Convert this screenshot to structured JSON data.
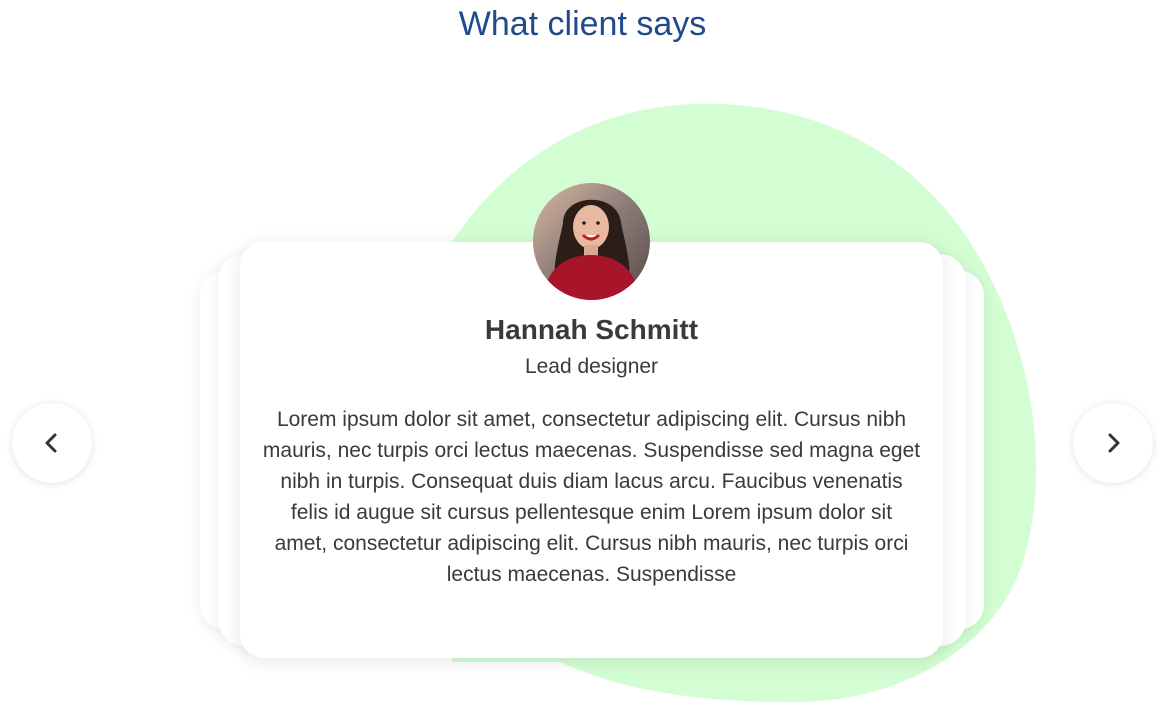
{
  "section": {
    "title": "What client says"
  },
  "testimonial": {
    "name": "Hannah Schmitt",
    "role": "Lead designer",
    "quote": "Lorem ipsum dolor sit amet, consectetur adipiscing elit. Cursus nibh mauris, nec turpis orci lectus maecenas. Suspendisse sed magna eget nibh in turpis. Consequat duis diam lacus arcu. Faucibus venenatis felis id augue sit cursus pellentesque enim Lorem ipsum dolor sit amet, consectetur adipiscing elit. Cursus nibh mauris, nec turpis orci lectus maecenas. Suspendisse"
  },
  "navigation": {
    "prev_icon": "chevron-left-icon",
    "next_icon": "chevron-right-icon"
  },
  "colors": {
    "title": "#1f4a8c",
    "blob": "#d3fdd3",
    "text": "#3a3a3a",
    "avatar_top": "#caa890",
    "shirt": "#a8142a"
  }
}
